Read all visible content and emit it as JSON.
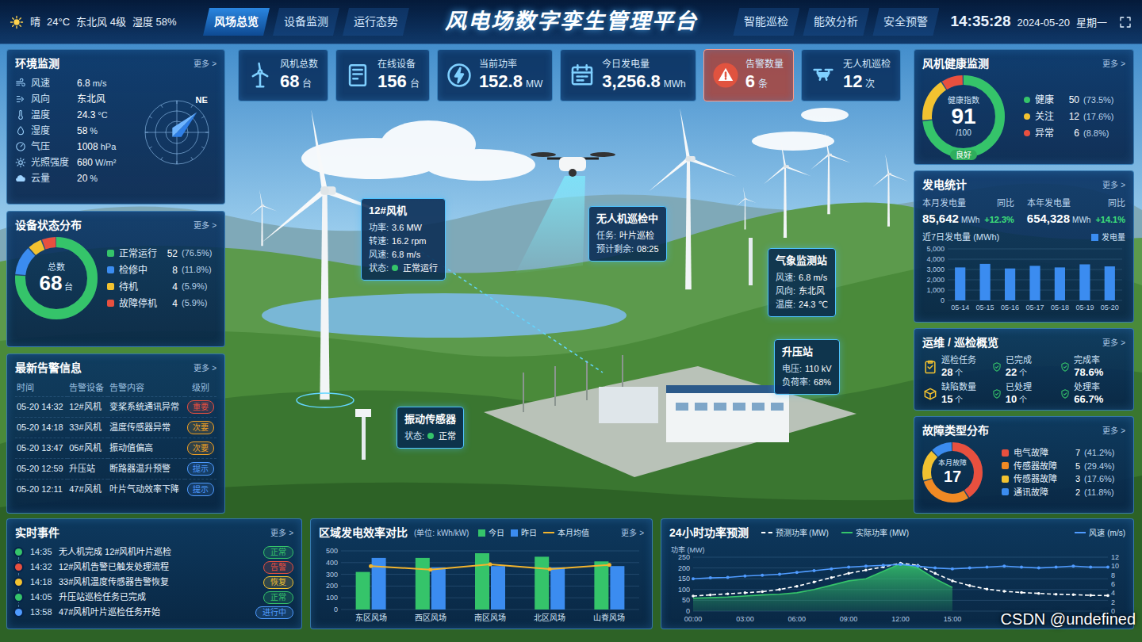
{
  "header": {
    "weather": {
      "condition": "晴",
      "temp": "24°C",
      "wind": "东北风 4级",
      "humidity": "湿度 58%"
    },
    "nav_left": [
      {
        "label": "风场总览",
        "selected": true
      },
      {
        "label": "设备监测",
        "selected": false
      },
      {
        "label": "运行态势",
        "selected": false
      }
    ],
    "title": "风电场数字孪生管理平台",
    "nav_right": [
      {
        "label": "智能巡检",
        "selected": false
      },
      {
        "label": "能效分析",
        "selected": false
      },
      {
        "label": "安全预警",
        "selected": false
      }
    ],
    "time": "14:35:28",
    "date": "2024-05-20",
    "weekday": "星期一"
  },
  "kpis": [
    {
      "label": "风机总数",
      "value": "68",
      "unit": "台",
      "alert": false
    },
    {
      "label": "在线设备",
      "value": "156",
      "unit": "台",
      "alert": false
    },
    {
      "label": "当前功率",
      "value": "152.8",
      "unit": "MW",
      "alert": false
    },
    {
      "label": "今日发电量",
      "value": "3,256.8",
      "unit": "MWh",
      "alert": false
    },
    {
      "label": "告警数量",
      "value": "6",
      "unit": "条",
      "alert": true
    },
    {
      "label": "无人机巡检",
      "value": "12",
      "unit": "次",
      "alert": false
    }
  ],
  "environment": {
    "title": "环境监测",
    "more": "更多 >",
    "rows": [
      {
        "label": "风速",
        "value": "6.8",
        "unit": "m/s"
      },
      {
        "label": "风向",
        "value": "东北风"
      },
      {
        "label": "温度",
        "value": "24.3",
        "unit": "°C"
      },
      {
        "label": "湿度",
        "value": "58",
        "unit": "%"
      },
      {
        "label": "气压",
        "value": "1008",
        "unit": "hPa"
      },
      {
        "label": "光照强度",
        "value": "680",
        "unit": "W/m²"
      },
      {
        "label": "云量",
        "value": "20",
        "unit": "%"
      }
    ],
    "compass_label": "NE"
  },
  "device_status": {
    "title": "设备状态分布",
    "more": "更多 >",
    "center_label": "总数",
    "total": "68",
    "unit": "台",
    "items": [
      {
        "label": "正常运行",
        "count": "52",
        "pct": "(76.5%)",
        "share": 0.765,
        "color": "#35c46a"
      },
      {
        "label": "检修中",
        "count": "8",
        "pct": "(11.8%)",
        "share": 0.118,
        "color": "#3b8cf0"
      },
      {
        "label": "待机",
        "count": "4",
        "pct": "(5.9%)",
        "share": 0.059,
        "color": "#f2c230"
      },
      {
        "label": "故障停机",
        "count": "4",
        "pct": "(5.9%)",
        "share": 0.059,
        "color": "#e8503f"
      }
    ]
  },
  "alerts": {
    "title": "最新告警信息",
    "more": "更多 >",
    "columns": [
      "时间",
      "告警设备",
      "告警内容",
      "级别"
    ],
    "rows": [
      {
        "time": "05-20 14:32",
        "device": "12#风机",
        "content": "变桨系统通讯异常",
        "level": "重要",
        "color": "#e8503f"
      },
      {
        "time": "05-20 14:18",
        "device": "33#风机",
        "content": "温度传感器异常",
        "level": "次要",
        "color": "#f0a024"
      },
      {
        "time": "05-20 13:47",
        "device": "05#风机",
        "content": "振动值偏高",
        "level": "次要",
        "color": "#f0a024"
      },
      {
        "time": "05-20 12:59",
        "device": "升压站",
        "content": "断路器温升预警",
        "level": "提示",
        "color": "#4f9bff"
      },
      {
        "time": "05-20 12:11",
        "device": "47#风机",
        "content": "叶片气动效率下降",
        "level": "提示",
        "color": "#4f9bff"
      }
    ]
  },
  "health": {
    "title": "风机健康监测",
    "more": "更多 >",
    "label": "健康指数",
    "score": "91",
    "max": "/100",
    "grade": "良好",
    "items": [
      {
        "label": "健康",
        "count": "50",
        "pct": "(73.5%)",
        "share": 0.735,
        "color": "#35c46a"
      },
      {
        "label": "关注",
        "count": "12",
        "pct": "(17.6%)",
        "share": 0.176,
        "color": "#f2c230"
      },
      {
        "label": "异常",
        "count": "6",
        "pct": "(8.8%)",
        "share": 0.088,
        "color": "#e8503f"
      }
    ]
  },
  "generation": {
    "title": "发电统计",
    "more": "更多 >",
    "stats": [
      {
        "label": "本月发电量",
        "value": "85,642",
        "unit": "MWh",
        "yoy_label": "同比",
        "yoy": "+12.3%"
      },
      {
        "label": "本年发电量",
        "value": "654,328",
        "unit": "MWh",
        "yoy_label": "同比",
        "yoy": "+14.1%"
      }
    ],
    "chart": {
      "title": "近7日发电量 (MWh)",
      "legend": "发电量",
      "color": "#3b8cf0",
      "y_ticks": [
        "5,000",
        "4,000",
        "3,000",
        "2,000",
        "1,000",
        "0"
      ],
      "x_labels": [
        "05-14",
        "05-15",
        "05-16",
        "05-17",
        "05-18",
        "05-19",
        "05-20"
      ],
      "values": [
        3200,
        3550,
        3100,
        3350,
        3200,
        3500,
        3300
      ]
    }
  },
  "ops": {
    "title": "运维 / 巡检概览",
    "more": "更多 >",
    "items": [
      {
        "label": "巡检任务",
        "value": "28",
        "unit": "个"
      },
      {
        "label": "已完成",
        "value": "22",
        "unit": "个"
      },
      {
        "label": "完成率",
        "value": "78.6%"
      },
      {
        "label": "缺陷数量",
        "value": "15",
        "unit": "个"
      },
      {
        "label": "已处理",
        "value": "10",
        "unit": "个"
      },
      {
        "label": "处理率",
        "value": "66.7%"
      }
    ]
  },
  "faults": {
    "title": "故障类型分布",
    "more": "更多 >",
    "center_label": "本月故障",
    "total": "17",
    "items": [
      {
        "label": "电气故障",
        "count": "7",
        "pct": "(41.2%)",
        "share": 0.412,
        "color": "#e8503f"
      },
      {
        "label": "传感器故障",
        "count": "5",
        "pct": "(29.4%)",
        "share": 0.294,
        "color": "#f08a24"
      },
      {
        "label": "传感器故障",
        "count": "3",
        "pct": "(17.6%)",
        "share": 0.176,
        "color": "#f2c230"
      },
      {
        "label": "通讯故障",
        "count": "2",
        "pct": "(11.8%)",
        "share": 0.118,
        "color": "#3b8cf0"
      }
    ]
  },
  "events": {
    "title": "实时事件",
    "more": "更多 >",
    "items": [
      {
        "time": "14:35",
        "text": "无人机完成 12#风机叶片巡检",
        "status": "正常",
        "color": "#35c46a"
      },
      {
        "time": "14:32",
        "text": "12#风机告警已触发处理流程",
        "status": "告警",
        "color": "#e8503f"
      },
      {
        "time": "14:18",
        "text": "33#风机温度传感器告警恢复",
        "status": "恢复",
        "color": "#f2c230"
      },
      {
        "time": "14:05",
        "text": "升压站巡检任务已完成",
        "status": "正常",
        "color": "#35c46a"
      },
      {
        "time": "13:58",
        "text": "47#风机叶片巡检任务开始",
        "status": "进行中",
        "color": "#4f9bff"
      }
    ]
  },
  "efficiency": {
    "title": "区域发电效率对比",
    "unit": "(单位: kWh/kW)",
    "more": "更多 >",
    "y_ticks": [
      "500",
      "400",
      "300",
      "200",
      "100",
      "0"
    ],
    "categories": [
      "东区风场",
      "西区风场",
      "南区风场",
      "北区风场",
      "山脊风场"
    ],
    "series": [
      {
        "label": "今日",
        "color": "#35c46a",
        "kind": "bar",
        "values": [
          320,
          440,
          480,
          450,
          410
        ]
      },
      {
        "label": "昨日",
        "color": "#3b8cf0",
        "kind": "bar",
        "values": [
          440,
          360,
          370,
          360,
          370
        ]
      },
      {
        "label": "本月均值",
        "color": "#f2b42e",
        "kind": "line",
        "values": [
          370,
          340,
          385,
          345,
          380
        ]
      }
    ]
  },
  "forecast": {
    "title": "24小时功率预测",
    "y_left_label": "功率 (MW)",
    "y_left_ticks": [
      "250",
      "200",
      "150",
      "100",
      "50",
      "0"
    ],
    "y_right_ticks": [
      "12",
      "10",
      "8",
      "6",
      "4",
      "2",
      "0"
    ],
    "x_labels": [
      "00:00",
      "03:00",
      "06:00",
      "09:00",
      "12:00",
      "15:00"
    ],
    "series": [
      {
        "label": "预测功率 (MW)",
        "color": "#ffffff",
        "kind": "forecast",
        "values": [
          70,
          75,
          80,
          85,
          90,
          100,
          115,
          135,
          155,
          175,
          190,
          205,
          222,
          212,
          175,
          140,
          118,
          102,
          92,
          86,
          82,
          78,
          76,
          73,
          72
        ]
      },
      {
        "label": "实际功率 (MW)",
        "color": "#35c46a",
        "kind": "actual",
        "values": [
          60,
          62,
          65,
          70,
          75,
          78,
          85,
          100,
          120,
          140,
          150,
          185,
          220,
          200,
          150,
          110
        ]
      },
      {
        "label": "风速 (m/s)",
        "color": "#4f9bff",
        "kind": "wind",
        "values": [
          7.2,
          7.4,
          7.5,
          7.8,
          8.0,
          8.2,
          8.6,
          9.0,
          9.4,
          9.8,
          10.0,
          10.2,
          10.4,
          10.0,
          9.6,
          9.4,
          9.6,
          9.8,
          10.0,
          9.8,
          9.6,
          9.8,
          10.0,
          9.8,
          9.8
        ]
      }
    ]
  },
  "map": {
    "pins": [
      {
        "title": "12#风机",
        "rows": [
          {
            "label": "功率:",
            "value": "3.6 MW"
          },
          {
            "label": "转速:",
            "value": "16.2 rpm"
          },
          {
            "label": "风速:",
            "value": "6.8 m/s"
          },
          {
            "label": "状态:",
            "value": "正常运行",
            "color": "#35c46a"
          }
        ]
      },
      {
        "title": "无人机巡检中",
        "rows": [
          {
            "label": "任务:",
            "value": "叶片巡检"
          },
          {
            "label": "预计剩余:",
            "value": "08:25"
          }
        ]
      },
      {
        "title": "气象监测站",
        "rows": [
          {
            "label": "风速:",
            "value": "6.8 m/s"
          },
          {
            "label": "风向:",
            "value": "东北风"
          },
          {
            "label": "温度:",
            "value": "24.3 ℃"
          }
        ]
      },
      {
        "title": "升压站",
        "rows": [
          {
            "label": "电压:",
            "value": "110 kV"
          },
          {
            "label": "负荷率:",
            "value": "68%"
          }
        ]
      },
      {
        "title": "振动传感器",
        "rows": [
          {
            "label": "状态:",
            "value": "正常",
            "color": "#35c46a"
          }
        ]
      }
    ]
  },
  "watermark": "CSDN @undefined"
}
